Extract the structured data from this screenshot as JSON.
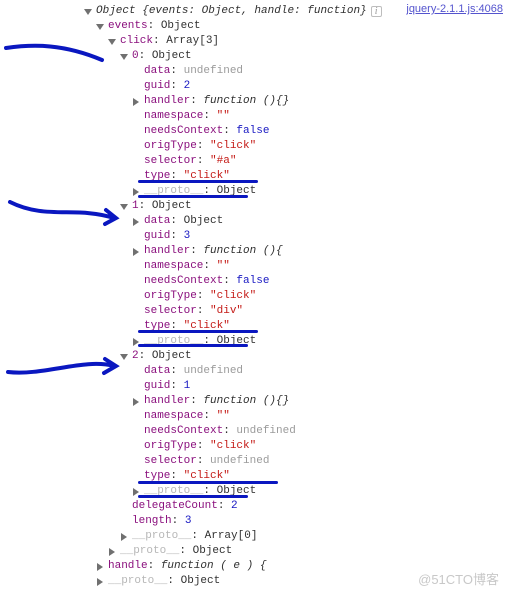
{
  "source_link": "jquery-2.1.1.js:4068",
  "watermark": "@51CTO博客",
  "root": {
    "name": "Object",
    "summary_html": "{events: Object, handle: function}",
    "events": {
      "label": "events",
      "type": "Object",
      "click": {
        "label": "click",
        "type": "Array[3]",
        "items": [
          {
            "index": "0",
            "type": "Object",
            "data_label": "data",
            "data_val": "undefined",
            "guid_label": "guid",
            "guid_val": "2",
            "handler_label": "handler",
            "handler_val": "function (){}",
            "namespace_label": "namespace",
            "namespace_val": "\"\"",
            "needsContext_label": "needsContext",
            "needsContext_val": "false",
            "origType_label": "origType",
            "origType_val": "\"click\"",
            "selector_label": "selector",
            "selector_val": "\"#a\"",
            "type_label": "type",
            "type_val": "\"click\"",
            "proto_label": "__proto__",
            "proto_val": "Object",
            "data_expandable": false
          },
          {
            "index": "1",
            "type": "Object",
            "data_label": "data",
            "data_val": "Object",
            "guid_label": "guid",
            "guid_val": "3",
            "handler_label": "handler",
            "handler_val": "function (){",
            "namespace_label": "namespace",
            "namespace_val": "\"\"",
            "needsContext_label": "needsContext",
            "needsContext_val": "false",
            "origType_label": "origType",
            "origType_val": "\"click\"",
            "selector_label": "selector",
            "selector_val": "\"div\"",
            "type_label": "type",
            "type_val": "\"click\"",
            "proto_label": "__proto__",
            "proto_val": "Object",
            "data_expandable": true
          },
          {
            "index": "2",
            "type": "Object",
            "data_label": "data",
            "data_val": "undefined",
            "guid_label": "guid",
            "guid_val": "1",
            "handler_label": "handler",
            "handler_val": "function (){}",
            "namespace_label": "namespace",
            "namespace_val": "\"\"",
            "needsContext_label": "needsContext",
            "needsContext_val": "undefined",
            "origType_label": "origType",
            "origType_val": "\"click\"",
            "selector_label": "selector",
            "selector_val": "undefined",
            "type_label": "type",
            "type_val": "\"click\"",
            "proto_label": "__proto__",
            "proto_val": "Object",
            "data_expandable": false
          }
        ],
        "delegateCount_label": "delegateCount",
        "delegateCount_val": "2",
        "length_label": "length",
        "length_val": "3",
        "proto_label": "__proto__",
        "proto_val": "Array[0]"
      },
      "proto_label": "__proto__",
      "proto_val": "Object"
    },
    "handle_label": "handle",
    "handle_val": "function ( e ) {",
    "proto_label": "__proto__",
    "proto_val": "Object"
  }
}
